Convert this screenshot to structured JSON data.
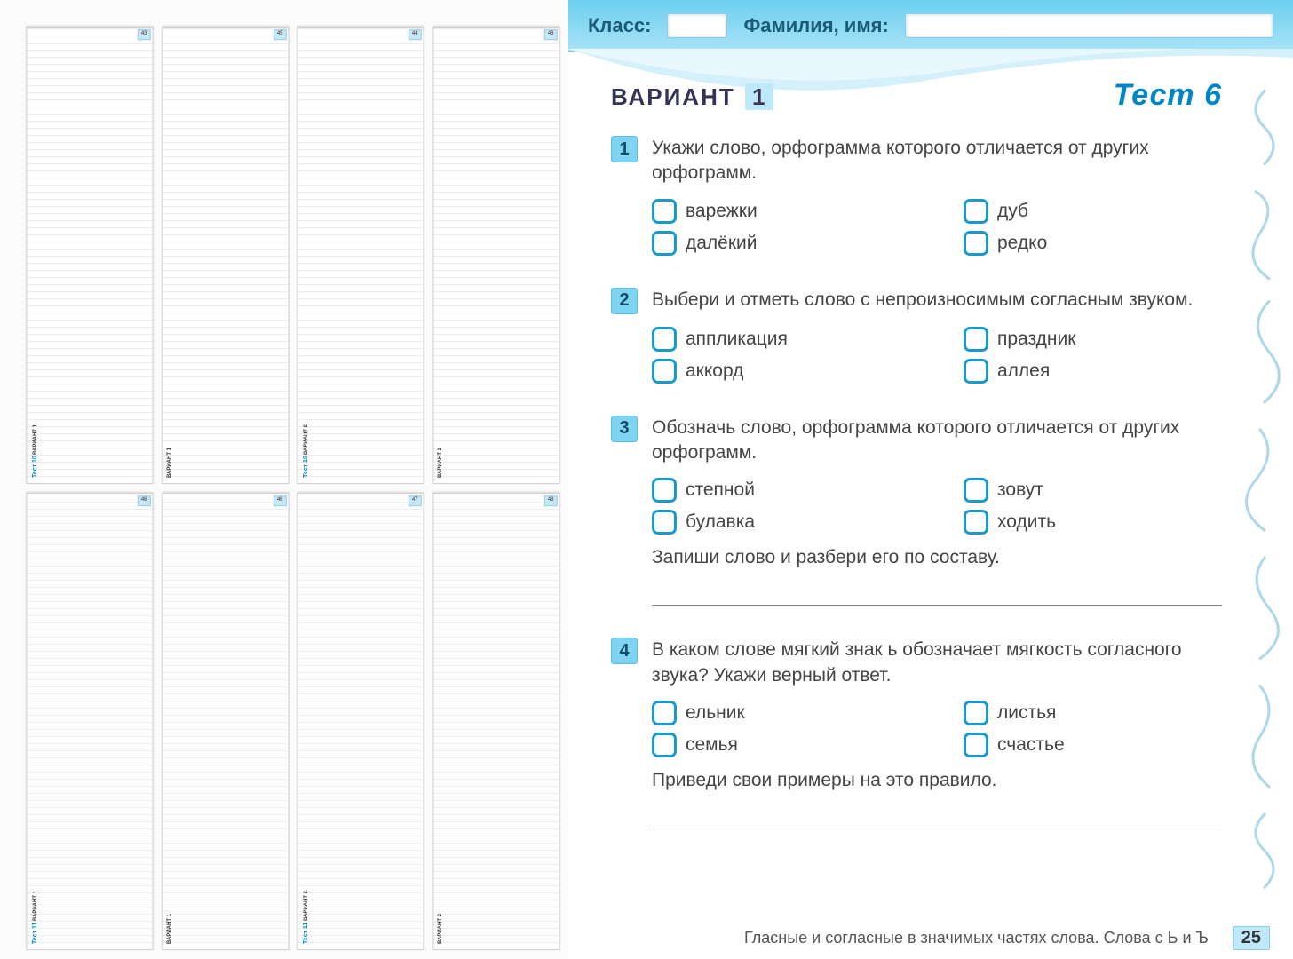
{
  "thumbnails": [
    {
      "variant": "ВАРИАНТ 1",
      "test": "Тест 10",
      "page": "43"
    },
    {
      "variant": "ВАРИАНТ 1",
      "test": "",
      "page": "45"
    },
    {
      "variant": "ВАРИАНТ 2",
      "test": "Тест 10",
      "page": "44"
    },
    {
      "variant": "ВАРИАНТ 2",
      "test": "",
      "page": "48"
    },
    {
      "variant": "ВАРИАНТ 1",
      "test": "Тест 11",
      "page": "46"
    },
    {
      "variant": "ВАРИАНТ 1",
      "test": "",
      "page": "46"
    },
    {
      "variant": "ВАРИАНТ 2",
      "test": "Тест 11",
      "page": "47"
    },
    {
      "variant": "ВАРИАНТ 2",
      "test": "",
      "page": "48"
    }
  ],
  "header": {
    "class_label": "Класс:",
    "name_label": "Фамилия, имя:"
  },
  "title": {
    "variant_word": "ВАРИАНТ",
    "variant_num": "1",
    "test_label": "Тест 6"
  },
  "questions": [
    {
      "num": "1",
      "text": "Укажи слово, орфограмма которого отличается от других орфограмм.",
      "options": [
        "варежки",
        "далёкий",
        "дуб",
        "редко"
      ]
    },
    {
      "num": "2",
      "text": "Выбери и отметь слово с непроизносимым согласным звуком.",
      "options": [
        "аппликация",
        "аккорд",
        "праздник",
        "аллея"
      ]
    },
    {
      "num": "3",
      "text": "Обозначь слово, орфограмма которого отличается от других орфограмм.",
      "options": [
        "степной",
        "булавка",
        "зовут",
        "ходить"
      ],
      "followup": "Запиши слово и разбери его по составу."
    },
    {
      "num": "4",
      "text": "В каком слове мягкий знак ь обозначает мягкость согласного звука? Укажи верный ответ.",
      "options": [
        "ельник",
        "семья",
        "листья",
        "счастье"
      ],
      "followup": "Приведи свои примеры на это правило."
    }
  ],
  "footer": {
    "text": "Гласные и согласные в значимых частях слова. Слова с Ь и Ъ",
    "page": "25"
  }
}
